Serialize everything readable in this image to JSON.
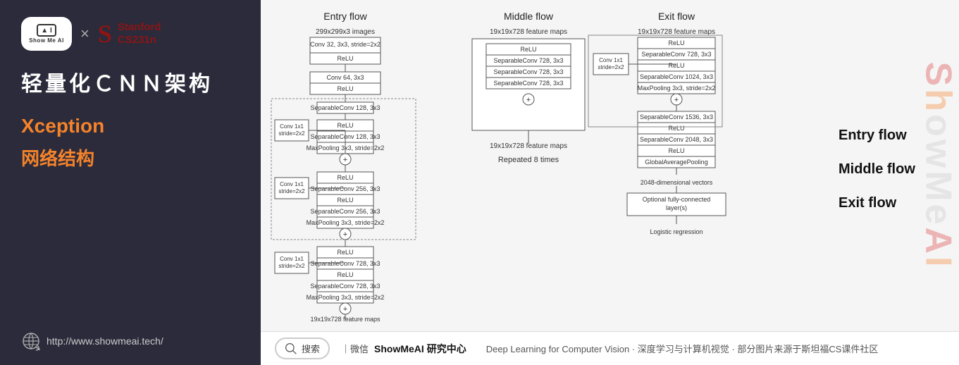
{
  "left": {
    "logo": {
      "icon_label": "▲ I",
      "showmeai_text": "Show Me AI",
      "times": "×",
      "stanford_s": "S",
      "stanford_name": "Stanford",
      "stanford_course": "CS231n"
    },
    "title": "轻量化ＣＮＮ架构",
    "subtitle_en": "Xception",
    "subtitle_cn": "网络结构",
    "website": "http://www.showmeai.tech/"
  },
  "diagram": {
    "entry_flow_label": "Entry flow",
    "middle_flow_label": "Middle flow",
    "exit_flow_label": "Exit flow"
  },
  "legend": {
    "items": [
      "Entry flow",
      "Middle flow",
      "Exit flow"
    ]
  },
  "watermark": "ShowMeAI",
  "footer": {
    "search_placeholder": "搜索",
    "divider": "｜微信",
    "brand": "ShowMeAI 研究中心",
    "description": "Deep Learning for Computer Vision · 深度学习与计算机视觉 · 部分图片来源于斯坦福CS课件社区"
  }
}
